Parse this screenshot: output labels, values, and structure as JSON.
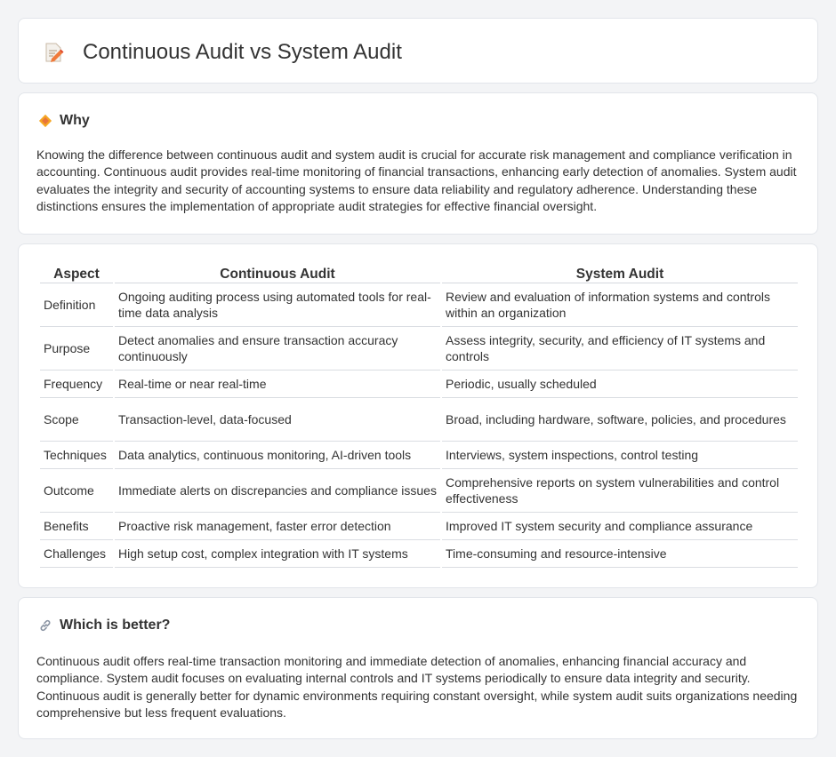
{
  "header": {
    "title": "Continuous Audit vs System Audit",
    "icon": "edit-document-icon"
  },
  "why": {
    "title": "Why",
    "icon": "diamond-sign-icon",
    "text": "Knowing the difference between continuous audit and system audit is crucial for accurate risk management and compliance verification in accounting. Continuous audit provides real-time monitoring of financial transactions, enhancing early detection of anomalies. System audit evaluates the integrity and security of accounting systems to ensure data reliability and regulatory adherence. Understanding these distinctions ensures the implementation of appropriate audit strategies for effective financial oversight."
  },
  "table": {
    "headers": [
      "Aspect",
      "Continuous Audit",
      "System Audit"
    ],
    "rows": [
      {
        "aspect": "Definition",
        "continuous": "Ongoing auditing process using automated tools for real-time data analysis",
        "system": "Review and evaluation of information systems and controls within an organization"
      },
      {
        "aspect": "Purpose",
        "continuous": "Detect anomalies and ensure transaction accuracy continuously",
        "system": "Assess integrity, security, and efficiency of IT systems and controls"
      },
      {
        "aspect": "Frequency",
        "continuous": "Real-time or near real-time",
        "system": "Periodic, usually scheduled"
      },
      {
        "aspect": "Scope",
        "continuous": "Transaction-level, data-focused",
        "system": "Broad, including hardware, software, policies, and procedures"
      },
      {
        "aspect": "Techniques",
        "continuous": "Data analytics, continuous monitoring, AI-driven tools",
        "system": "Interviews, system inspections, control testing"
      },
      {
        "aspect": "Outcome",
        "continuous": "Immediate alerts on discrepancies and compliance issues",
        "system": "Comprehensive reports on system vulnerabilities and control effectiveness"
      },
      {
        "aspect": "Benefits",
        "continuous": "Proactive risk management, faster error detection",
        "system": "Improved IT system security and compliance assurance"
      },
      {
        "aspect": "Challenges",
        "continuous": "High setup cost, complex integration with IT systems",
        "system": "Time-consuming and resource-intensive"
      }
    ]
  },
  "better": {
    "title": "Which is better?",
    "icon": "link-icon",
    "text": "Continuous audit offers real-time transaction monitoring and immediate detection of anomalies, enhancing financial accuracy and compliance. System audit focuses on evaluating internal controls and IT systems periodically to ensure data integrity and security. Continuous audit is generally better for dynamic environments requiring constant oversight, while system audit suits organizations needing comprehensive but less frequent evaluations."
  }
}
